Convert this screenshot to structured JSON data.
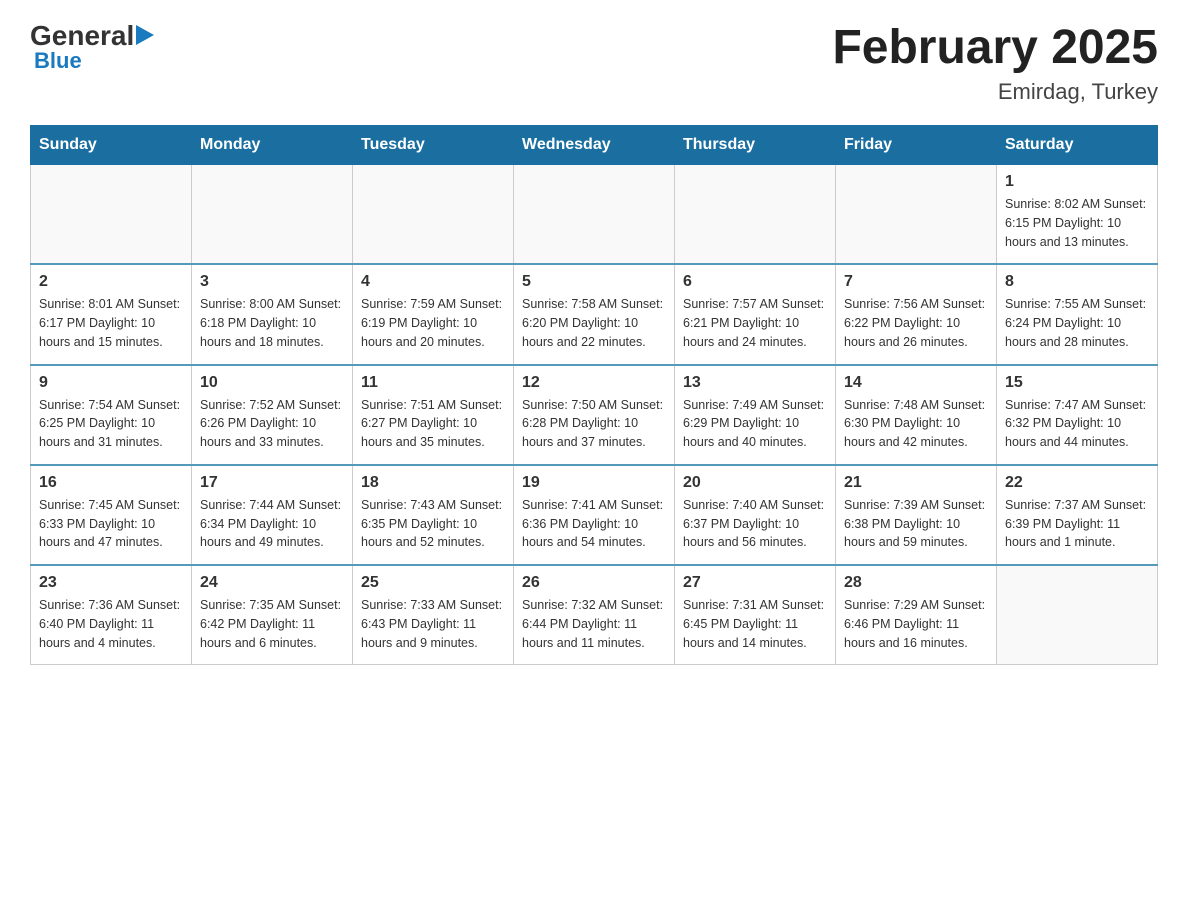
{
  "header": {
    "logo": {
      "general": "General",
      "blue": "Blue"
    },
    "title": "February 2025",
    "location": "Emirdag, Turkey"
  },
  "days_of_week": [
    "Sunday",
    "Monday",
    "Tuesday",
    "Wednesday",
    "Thursday",
    "Friday",
    "Saturday"
  ],
  "weeks": [
    [
      {
        "day": "",
        "info": ""
      },
      {
        "day": "",
        "info": ""
      },
      {
        "day": "",
        "info": ""
      },
      {
        "day": "",
        "info": ""
      },
      {
        "day": "",
        "info": ""
      },
      {
        "day": "",
        "info": ""
      },
      {
        "day": "1",
        "info": "Sunrise: 8:02 AM\nSunset: 6:15 PM\nDaylight: 10 hours and 13 minutes."
      }
    ],
    [
      {
        "day": "2",
        "info": "Sunrise: 8:01 AM\nSunset: 6:17 PM\nDaylight: 10 hours and 15 minutes."
      },
      {
        "day": "3",
        "info": "Sunrise: 8:00 AM\nSunset: 6:18 PM\nDaylight: 10 hours and 18 minutes."
      },
      {
        "day": "4",
        "info": "Sunrise: 7:59 AM\nSunset: 6:19 PM\nDaylight: 10 hours and 20 minutes."
      },
      {
        "day": "5",
        "info": "Sunrise: 7:58 AM\nSunset: 6:20 PM\nDaylight: 10 hours and 22 minutes."
      },
      {
        "day": "6",
        "info": "Sunrise: 7:57 AM\nSunset: 6:21 PM\nDaylight: 10 hours and 24 minutes."
      },
      {
        "day": "7",
        "info": "Sunrise: 7:56 AM\nSunset: 6:22 PM\nDaylight: 10 hours and 26 minutes."
      },
      {
        "day": "8",
        "info": "Sunrise: 7:55 AM\nSunset: 6:24 PM\nDaylight: 10 hours and 28 minutes."
      }
    ],
    [
      {
        "day": "9",
        "info": "Sunrise: 7:54 AM\nSunset: 6:25 PM\nDaylight: 10 hours and 31 minutes."
      },
      {
        "day": "10",
        "info": "Sunrise: 7:52 AM\nSunset: 6:26 PM\nDaylight: 10 hours and 33 minutes."
      },
      {
        "day": "11",
        "info": "Sunrise: 7:51 AM\nSunset: 6:27 PM\nDaylight: 10 hours and 35 minutes."
      },
      {
        "day": "12",
        "info": "Sunrise: 7:50 AM\nSunset: 6:28 PM\nDaylight: 10 hours and 37 minutes."
      },
      {
        "day": "13",
        "info": "Sunrise: 7:49 AM\nSunset: 6:29 PM\nDaylight: 10 hours and 40 minutes."
      },
      {
        "day": "14",
        "info": "Sunrise: 7:48 AM\nSunset: 6:30 PM\nDaylight: 10 hours and 42 minutes."
      },
      {
        "day": "15",
        "info": "Sunrise: 7:47 AM\nSunset: 6:32 PM\nDaylight: 10 hours and 44 minutes."
      }
    ],
    [
      {
        "day": "16",
        "info": "Sunrise: 7:45 AM\nSunset: 6:33 PM\nDaylight: 10 hours and 47 minutes."
      },
      {
        "day": "17",
        "info": "Sunrise: 7:44 AM\nSunset: 6:34 PM\nDaylight: 10 hours and 49 minutes."
      },
      {
        "day": "18",
        "info": "Sunrise: 7:43 AM\nSunset: 6:35 PM\nDaylight: 10 hours and 52 minutes."
      },
      {
        "day": "19",
        "info": "Sunrise: 7:41 AM\nSunset: 6:36 PM\nDaylight: 10 hours and 54 minutes."
      },
      {
        "day": "20",
        "info": "Sunrise: 7:40 AM\nSunset: 6:37 PM\nDaylight: 10 hours and 56 minutes."
      },
      {
        "day": "21",
        "info": "Sunrise: 7:39 AM\nSunset: 6:38 PM\nDaylight: 10 hours and 59 minutes."
      },
      {
        "day": "22",
        "info": "Sunrise: 7:37 AM\nSunset: 6:39 PM\nDaylight: 11 hours and 1 minute."
      }
    ],
    [
      {
        "day": "23",
        "info": "Sunrise: 7:36 AM\nSunset: 6:40 PM\nDaylight: 11 hours and 4 minutes."
      },
      {
        "day": "24",
        "info": "Sunrise: 7:35 AM\nSunset: 6:42 PM\nDaylight: 11 hours and 6 minutes."
      },
      {
        "day": "25",
        "info": "Sunrise: 7:33 AM\nSunset: 6:43 PM\nDaylight: 11 hours and 9 minutes."
      },
      {
        "day": "26",
        "info": "Sunrise: 7:32 AM\nSunset: 6:44 PM\nDaylight: 11 hours and 11 minutes."
      },
      {
        "day": "27",
        "info": "Sunrise: 7:31 AM\nSunset: 6:45 PM\nDaylight: 11 hours and 14 minutes."
      },
      {
        "day": "28",
        "info": "Sunrise: 7:29 AM\nSunset: 6:46 PM\nDaylight: 11 hours and 16 minutes."
      },
      {
        "day": "",
        "info": ""
      }
    ]
  ]
}
